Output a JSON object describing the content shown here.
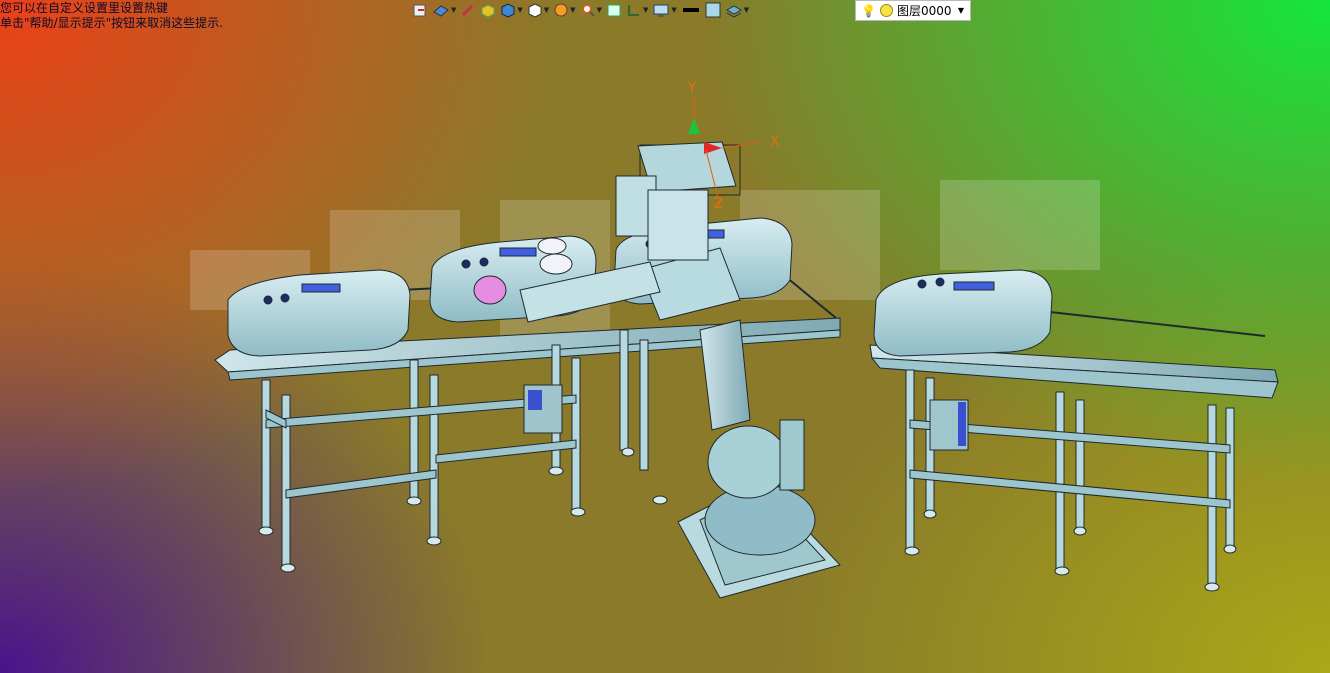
{
  "hint_lines": [
    "您可以在自定义设置里设置热键",
    "单击\"帮助/显示提示\"按钮来取消这些提示."
  ],
  "toolbar": {
    "tools": [
      "import-icon",
      "render-icon",
      "pick-icon",
      "box-icon",
      "solid-icon",
      "cube-view-icon",
      "sphere-view-icon",
      "zoom-icon",
      "fit-icon",
      "section-icon",
      "display-icon",
      "line-color-icon",
      "fill-color-icon",
      "layer-stack-icon"
    ],
    "layer": {
      "name": "图层0000",
      "bulb": "💡"
    }
  },
  "triad": {
    "x_label": "X",
    "y_label": "Y",
    "z_label": "Z"
  },
  "colors": {
    "part": "#a9d3da",
    "edge": "#1f2a2f",
    "accent": "#3a4fd0"
  }
}
